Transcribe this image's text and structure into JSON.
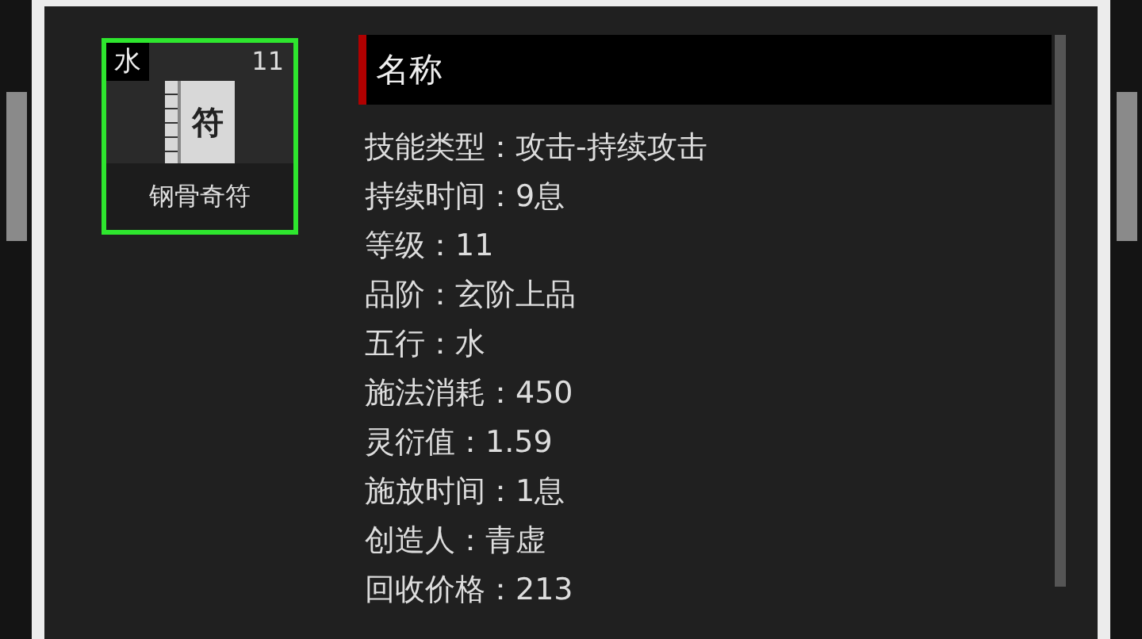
{
  "item": {
    "element": "水",
    "level": "11",
    "glyph": "符",
    "name": "钢骨奇符"
  },
  "detail": {
    "title": "名称",
    "properties": [
      "技能类型：攻击-持续攻击",
      "持续时间：9息",
      "等级：11",
      "品阶：玄阶上品",
      "五行：水",
      "施法消耗：450",
      "灵衍值：1.59",
      "施放时间：1息",
      "创造人：青虚",
      "回收价格：213"
    ]
  }
}
